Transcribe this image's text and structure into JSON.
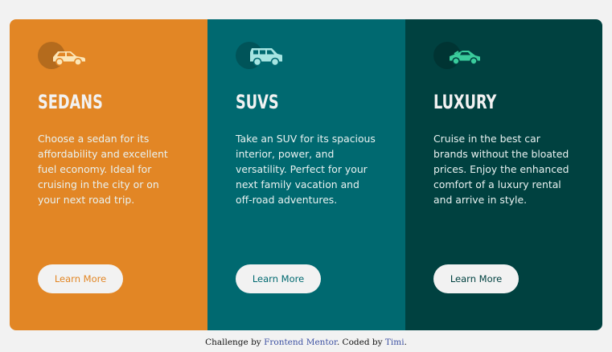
{
  "colors": {
    "page_background": "#f2f2f2",
    "sedans": "#e28625",
    "suvs": "#006970",
    "luxury": "#004140",
    "button_background": "#f2f2f2",
    "heading_text": "#f2f2f2",
    "body_text": "#e9f2f1",
    "link": "#3e52a3"
  },
  "cards": [
    {
      "title": "SEDANS",
      "text": "Choose a sedan for its affordability and excellent fuel economy. Ideal for cruising in the city or on your next road trip.",
      "button_label": "Learn More",
      "icon": "sedan-car-icon"
    },
    {
      "title": "SUVS",
      "text": "Take an SUV for its spacious interior, power, and versatility. Perfect for your next family vacation and off-road adventures.",
      "button_label": "Learn More",
      "icon": "suv-car-icon"
    },
    {
      "title": "LUXURY",
      "text": "Cruise in the best car brands without the bloated prices. Enjoy the enhanced comfort of a luxury rental and arrive in style.",
      "button_label": "Learn More",
      "icon": "luxury-car-icon"
    }
  ],
  "attribution": {
    "prefix": "Challenge by ",
    "frontend_mentor": "Frontend Mentor",
    "middle": ". Coded by ",
    "author": "Timi",
    "suffix": "."
  }
}
